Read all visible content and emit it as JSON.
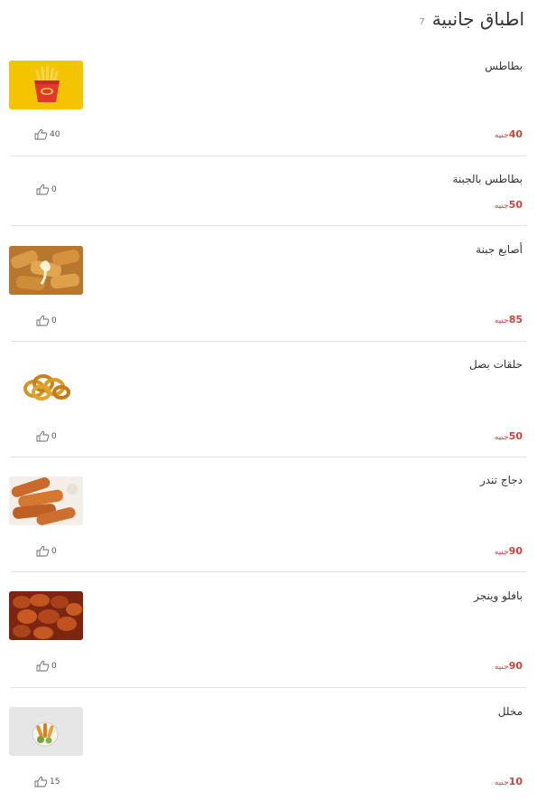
{
  "section": {
    "title": "اطباق جانبية",
    "count": "7"
  },
  "currency": "جنيه",
  "items": [
    {
      "name": "بطاطس",
      "price": "40",
      "likes": "40",
      "image": "fries-image"
    },
    {
      "name": "بطاطس بالجبنة",
      "price": "50",
      "likes": "0",
      "image": null
    },
    {
      "name": "أصابع جبنة",
      "price": "85",
      "likes": "0",
      "image": "cheese-sticks-image"
    },
    {
      "name": "حلقات بصل",
      "price": "50",
      "likes": "0",
      "image": "onion-rings-image"
    },
    {
      "name": "دجاج تندر",
      "price": "90",
      "likes": "0",
      "image": "chicken-tenders-image"
    },
    {
      "name": "بافلو وينجز",
      "price": "90",
      "likes": "0",
      "image": "buffalo-wings-image"
    },
    {
      "name": "مخلل",
      "price": "10",
      "likes": "15",
      "image": "pickles-image"
    }
  ],
  "colors": {
    "price": "#c9463d",
    "divider": "#e2e2e2",
    "text": "#333333"
  }
}
